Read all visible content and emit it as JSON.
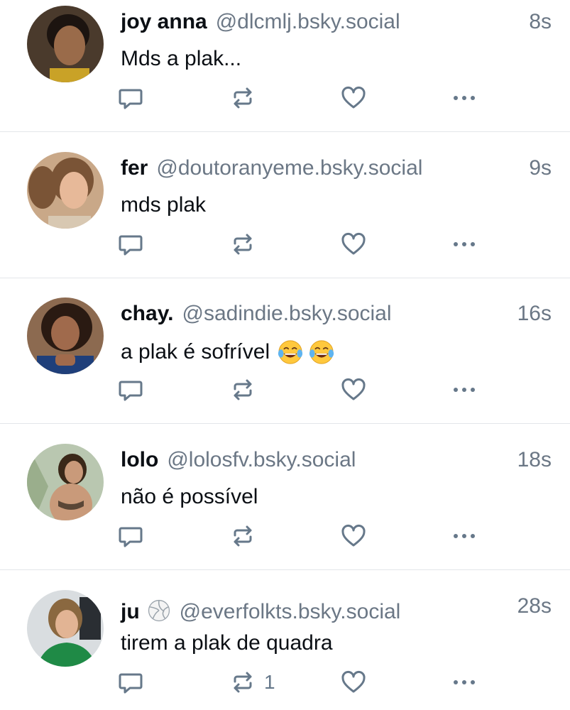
{
  "posts": [
    {
      "name": "joy anna",
      "handle": "@dlcmlj.bsky.social",
      "time": "8s",
      "text": "Mds a plak...",
      "repost_count": "",
      "avatar_desc": "avatar-photo",
      "avatar_colors": {
        "bg": "#4a3a2c",
        "skin": "#9a6b4a",
        "hair": "#1c1410",
        "shirt": "#c9a227"
      }
    },
    {
      "name": "fer",
      "handle": "@doutoranyeme.bsky.social",
      "time": "9s",
      "text": "mds plak",
      "repost_count": "",
      "avatar_desc": "avatar-photo",
      "avatar_colors": {
        "bg": "#c9a888",
        "skin": "#e7b999",
        "hair": "#7a5436",
        "shirt": "#d8c8b2"
      }
    },
    {
      "name": "chay.",
      "handle": "@sadindie.bsky.social",
      "time": "16s",
      "text": "a plak é sofrível",
      "emojis": [
        "face-with-tears-of-joy",
        "face-with-tears-of-joy"
      ],
      "repost_count": "",
      "avatar_desc": "avatar-photo",
      "avatar_colors": {
        "bg": "#8c6a50",
        "skin": "#a06a4c",
        "hair": "#2a1a12",
        "shirt": "#1f3f7a"
      }
    },
    {
      "name": "lolo",
      "handle": "@lolosfv.bsky.social",
      "time": "18s",
      "text": "não é possível",
      "repost_count": "",
      "avatar_desc": "avatar-photo",
      "avatar_colors": {
        "bg": "#b9c7b0",
        "skin": "#c99a7a",
        "hair": "#3a2818",
        "shirt": "#5a4636"
      }
    },
    {
      "name": "ju",
      "name_emoji": "volleyball",
      "handle": "@everfolkts.bsky.social",
      "time": "28s",
      "text": "tirem a plak de quadra",
      "repost_count": "1",
      "avatar_desc": "avatar-photo",
      "avatar_colors": {
        "bg": "#d9dde0",
        "skin": "#e2b494",
        "hair": "#8a6840",
        "shirt": "#1f8a46"
      }
    }
  ],
  "icons": {
    "reply": "reply-icon",
    "repost": "repost-icon",
    "like": "heart-icon",
    "more": "more-options-icon"
  },
  "colors": {
    "text_primary": "#0b0f14",
    "text_secondary": "#6b7785",
    "divider": "#e3e6ea",
    "icon": "#66788a"
  }
}
